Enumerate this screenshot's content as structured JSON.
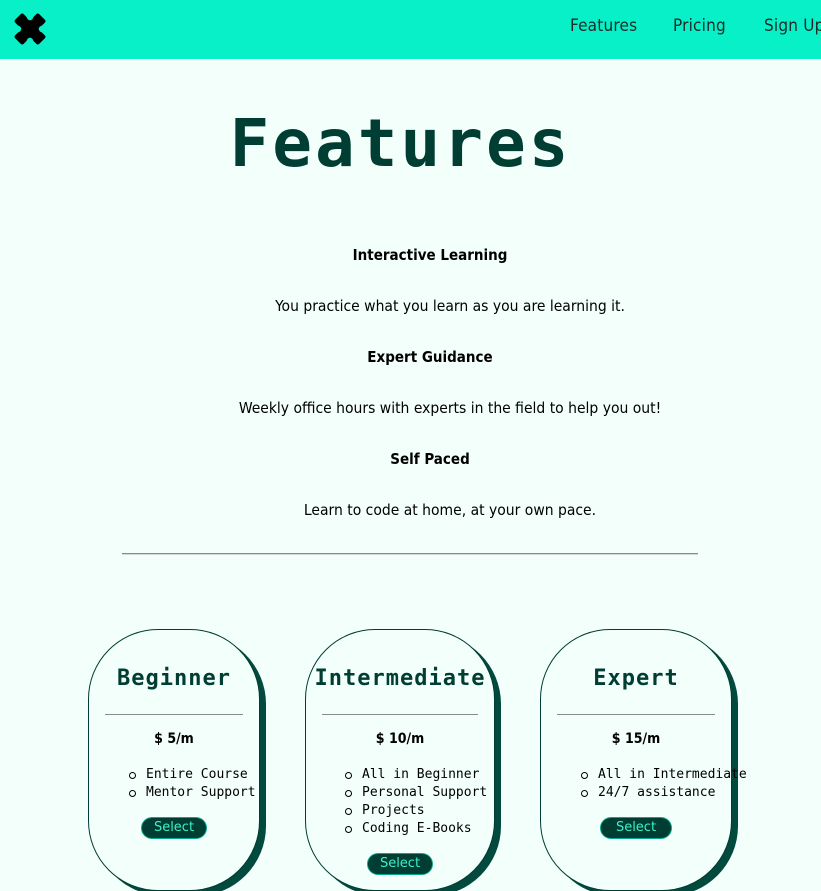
{
  "nav": {
    "logo_icon": "puzzle-cross-logo-icon",
    "links": [
      "Features",
      "Pricing",
      "Sign Up"
    ]
  },
  "page_title": "Features",
  "features": [
    {
      "heading": "Interactive Learning",
      "text": "You practice what you learn as you are learning it."
    },
    {
      "heading": "Expert Guidance",
      "text": "Weekly office hours with experts in the field to help you out!"
    },
    {
      "heading": "Self Paced",
      "text": "Learn to code at home, at your own pace."
    }
  ],
  "plans": [
    {
      "name": "Beginner",
      "price": "$ 5/m",
      "items": [
        "Entire Course",
        "Mentor Support"
      ],
      "button": "Select"
    },
    {
      "name": "Intermediate",
      "price": "$ 10/m",
      "items": [
        "All in Beginner",
        "Personal Support",
        "Projects",
        "Coding E-Books"
      ],
      "button": "Select"
    },
    {
      "name": "Expert",
      "price": "$ 15/m",
      "items": [
        "All in Intermediate",
        "24/7 assistance"
      ],
      "button": "Select"
    }
  ],
  "colors": {
    "nav_bg": "#07f0c8",
    "page_bg": "#f3fffb",
    "dark_green": "#003d33",
    "button_text": "#3ff0c9"
  }
}
